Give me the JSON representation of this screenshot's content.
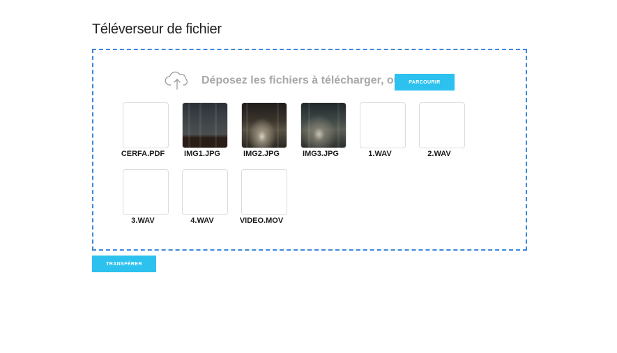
{
  "page": {
    "title": "Téléverseur de fichier"
  },
  "dropzone": {
    "prompt": "Déposez les fichiers à télécharger, ou",
    "browse_label": "PARCOURIR",
    "icon": "cloud-upload-icon",
    "border_color": "#3d87d9"
  },
  "files": [
    {
      "name": "CERFA.PDF",
      "preview": "none"
    },
    {
      "name": "IMG1.JPG",
      "preview": "photo"
    },
    {
      "name": "IMG2.JPG",
      "preview": "photo"
    },
    {
      "name": "IMG3.JPG",
      "preview": "photo"
    },
    {
      "name": "1.WAV",
      "preview": "none"
    },
    {
      "name": "2.WAV",
      "preview": "none"
    },
    {
      "name": "3.WAV",
      "preview": "none"
    },
    {
      "name": "4.WAV",
      "preview": "none"
    },
    {
      "name": "VIDEO.MOV",
      "preview": "none"
    }
  ],
  "actions": {
    "transfer_label": "TRANSFÉRER"
  },
  "colors": {
    "accent": "#2cc1ee",
    "prompt_text": "#a8a8a8"
  }
}
